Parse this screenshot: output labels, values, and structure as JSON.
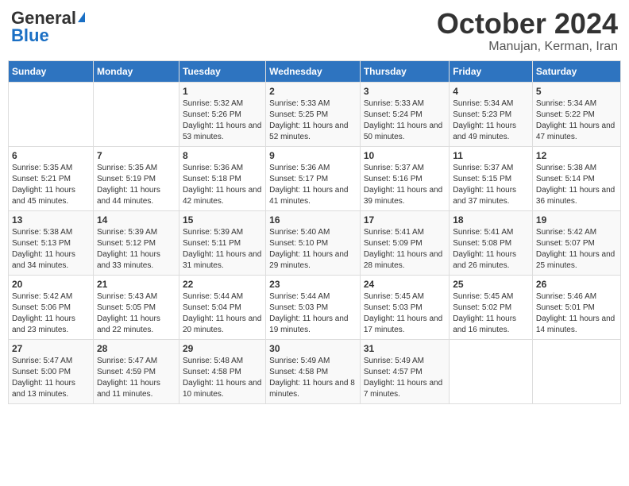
{
  "header": {
    "logo_line1": "General",
    "logo_line2": "Blue",
    "title": "October 2024",
    "subtitle": "Manujan, Kerman, Iran"
  },
  "columns": [
    "Sunday",
    "Monday",
    "Tuesday",
    "Wednesday",
    "Thursday",
    "Friday",
    "Saturday"
  ],
  "weeks": [
    [
      {
        "day": "",
        "sunrise": "",
        "sunset": "",
        "daylight": ""
      },
      {
        "day": "",
        "sunrise": "",
        "sunset": "",
        "daylight": ""
      },
      {
        "day": "1",
        "sunrise": "Sunrise: 5:32 AM",
        "sunset": "Sunset: 5:26 PM",
        "daylight": "Daylight: 11 hours and 53 minutes."
      },
      {
        "day": "2",
        "sunrise": "Sunrise: 5:33 AM",
        "sunset": "Sunset: 5:25 PM",
        "daylight": "Daylight: 11 hours and 52 minutes."
      },
      {
        "day": "3",
        "sunrise": "Sunrise: 5:33 AM",
        "sunset": "Sunset: 5:24 PM",
        "daylight": "Daylight: 11 hours and 50 minutes."
      },
      {
        "day": "4",
        "sunrise": "Sunrise: 5:34 AM",
        "sunset": "Sunset: 5:23 PM",
        "daylight": "Daylight: 11 hours and 49 minutes."
      },
      {
        "day": "5",
        "sunrise": "Sunrise: 5:34 AM",
        "sunset": "Sunset: 5:22 PM",
        "daylight": "Daylight: 11 hours and 47 minutes."
      }
    ],
    [
      {
        "day": "6",
        "sunrise": "Sunrise: 5:35 AM",
        "sunset": "Sunset: 5:21 PM",
        "daylight": "Daylight: 11 hours and 45 minutes."
      },
      {
        "day": "7",
        "sunrise": "Sunrise: 5:35 AM",
        "sunset": "Sunset: 5:19 PM",
        "daylight": "Daylight: 11 hours and 44 minutes."
      },
      {
        "day": "8",
        "sunrise": "Sunrise: 5:36 AM",
        "sunset": "Sunset: 5:18 PM",
        "daylight": "Daylight: 11 hours and 42 minutes."
      },
      {
        "day": "9",
        "sunrise": "Sunrise: 5:36 AM",
        "sunset": "Sunset: 5:17 PM",
        "daylight": "Daylight: 11 hours and 41 minutes."
      },
      {
        "day": "10",
        "sunrise": "Sunrise: 5:37 AM",
        "sunset": "Sunset: 5:16 PM",
        "daylight": "Daylight: 11 hours and 39 minutes."
      },
      {
        "day": "11",
        "sunrise": "Sunrise: 5:37 AM",
        "sunset": "Sunset: 5:15 PM",
        "daylight": "Daylight: 11 hours and 37 minutes."
      },
      {
        "day": "12",
        "sunrise": "Sunrise: 5:38 AM",
        "sunset": "Sunset: 5:14 PM",
        "daylight": "Daylight: 11 hours and 36 minutes."
      }
    ],
    [
      {
        "day": "13",
        "sunrise": "Sunrise: 5:38 AM",
        "sunset": "Sunset: 5:13 PM",
        "daylight": "Daylight: 11 hours and 34 minutes."
      },
      {
        "day": "14",
        "sunrise": "Sunrise: 5:39 AM",
        "sunset": "Sunset: 5:12 PM",
        "daylight": "Daylight: 11 hours and 33 minutes."
      },
      {
        "day": "15",
        "sunrise": "Sunrise: 5:39 AM",
        "sunset": "Sunset: 5:11 PM",
        "daylight": "Daylight: 11 hours and 31 minutes."
      },
      {
        "day": "16",
        "sunrise": "Sunrise: 5:40 AM",
        "sunset": "Sunset: 5:10 PM",
        "daylight": "Daylight: 11 hours and 29 minutes."
      },
      {
        "day": "17",
        "sunrise": "Sunrise: 5:41 AM",
        "sunset": "Sunset: 5:09 PM",
        "daylight": "Daylight: 11 hours and 28 minutes."
      },
      {
        "day": "18",
        "sunrise": "Sunrise: 5:41 AM",
        "sunset": "Sunset: 5:08 PM",
        "daylight": "Daylight: 11 hours and 26 minutes."
      },
      {
        "day": "19",
        "sunrise": "Sunrise: 5:42 AM",
        "sunset": "Sunset: 5:07 PM",
        "daylight": "Daylight: 11 hours and 25 minutes."
      }
    ],
    [
      {
        "day": "20",
        "sunrise": "Sunrise: 5:42 AM",
        "sunset": "Sunset: 5:06 PM",
        "daylight": "Daylight: 11 hours and 23 minutes."
      },
      {
        "day": "21",
        "sunrise": "Sunrise: 5:43 AM",
        "sunset": "Sunset: 5:05 PM",
        "daylight": "Daylight: 11 hours and 22 minutes."
      },
      {
        "day": "22",
        "sunrise": "Sunrise: 5:44 AM",
        "sunset": "Sunset: 5:04 PM",
        "daylight": "Daylight: 11 hours and 20 minutes."
      },
      {
        "day": "23",
        "sunrise": "Sunrise: 5:44 AM",
        "sunset": "Sunset: 5:03 PM",
        "daylight": "Daylight: 11 hours and 19 minutes."
      },
      {
        "day": "24",
        "sunrise": "Sunrise: 5:45 AM",
        "sunset": "Sunset: 5:03 PM",
        "daylight": "Daylight: 11 hours and 17 minutes."
      },
      {
        "day": "25",
        "sunrise": "Sunrise: 5:45 AM",
        "sunset": "Sunset: 5:02 PM",
        "daylight": "Daylight: 11 hours and 16 minutes."
      },
      {
        "day": "26",
        "sunrise": "Sunrise: 5:46 AM",
        "sunset": "Sunset: 5:01 PM",
        "daylight": "Daylight: 11 hours and 14 minutes."
      }
    ],
    [
      {
        "day": "27",
        "sunrise": "Sunrise: 5:47 AM",
        "sunset": "Sunset: 5:00 PM",
        "daylight": "Daylight: 11 hours and 13 minutes."
      },
      {
        "day": "28",
        "sunrise": "Sunrise: 5:47 AM",
        "sunset": "Sunset: 4:59 PM",
        "daylight": "Daylight: 11 hours and 11 minutes."
      },
      {
        "day": "29",
        "sunrise": "Sunrise: 5:48 AM",
        "sunset": "Sunset: 4:58 PM",
        "daylight": "Daylight: 11 hours and 10 minutes."
      },
      {
        "day": "30",
        "sunrise": "Sunrise: 5:49 AM",
        "sunset": "Sunset: 4:58 PM",
        "daylight": "Daylight: 11 hours and 8 minutes."
      },
      {
        "day": "31",
        "sunrise": "Sunrise: 5:49 AM",
        "sunset": "Sunset: 4:57 PM",
        "daylight": "Daylight: 11 hours and 7 minutes."
      },
      {
        "day": "",
        "sunrise": "",
        "sunset": "",
        "daylight": ""
      },
      {
        "day": "",
        "sunrise": "",
        "sunset": "",
        "daylight": ""
      }
    ]
  ]
}
